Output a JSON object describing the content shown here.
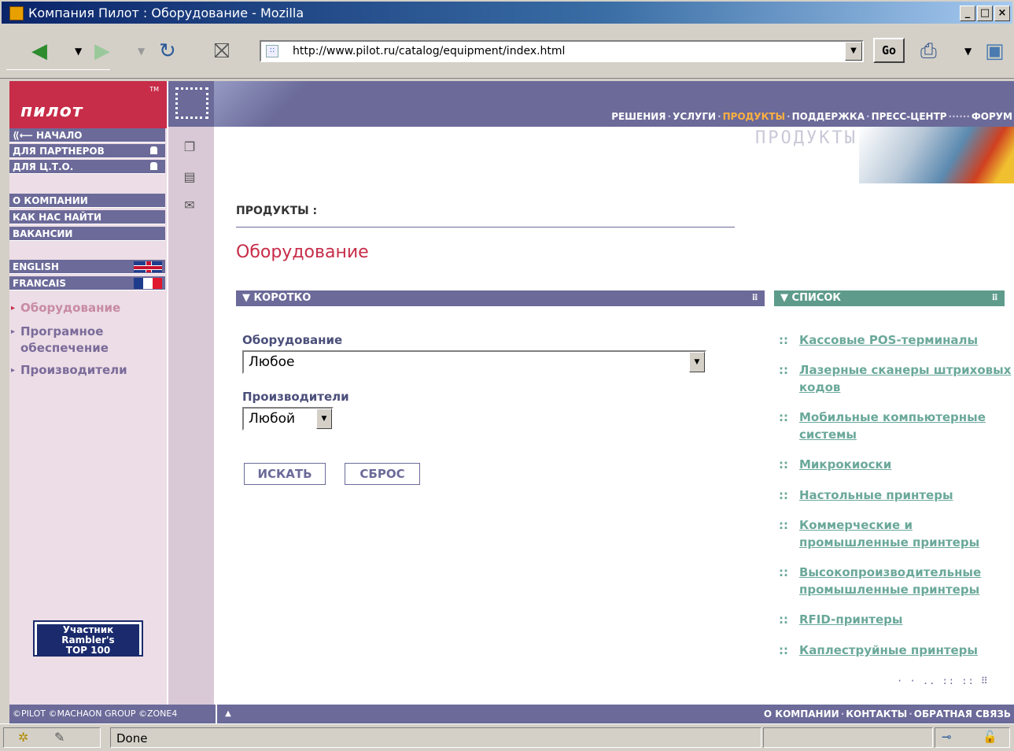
{
  "window": {
    "title": "Компания Пилот : Оборудование - Mozilla",
    "min_label": "_",
    "max_label": "□",
    "close_label": "×"
  },
  "toolbar": {
    "url": "http://www.pilot.ru/catalog/equipment/index.html",
    "go_label": "Go"
  },
  "sidebar": {
    "logo": "пилот",
    "logo_tm": "TM",
    "nav_top": [
      {
        "label": "⟪⟵ НАЧАЛО"
      },
      {
        "label": "ДЛЯ ПАРТНЕРОВ"
      },
      {
        "label": "ДЛЯ Ц.Т.О."
      }
    ],
    "nav_mid": [
      {
        "label": "О КОМПАНИИ"
      },
      {
        "label": "КАК НАС НАЙТИ"
      },
      {
        "label": "ВАКАНСИИ"
      }
    ],
    "lang": [
      {
        "label": "ENGLISH"
      },
      {
        "label": "FRANCAIS"
      }
    ],
    "links": [
      {
        "label": "Оборудование"
      },
      {
        "label": "Програмное обеспечение"
      },
      {
        "label": "Производители"
      }
    ],
    "rambler": [
      "Участник",
      "Rambler's",
      "TOP 100"
    ]
  },
  "topnav": {
    "items": [
      "РЕШЕНИЯ",
      "УСЛУГИ",
      "ПРОДУКТЫ",
      "ПОДДЕРЖКА",
      "ПРЕСС-ЦЕНТР",
      "ФОРУМ"
    ],
    "active": "ПРОДУКТЫ"
  },
  "hero": {
    "title": "ПРОДУКТЫ"
  },
  "content": {
    "breadcrumb": "ПРОДУКТЫ :",
    "page_title": "Оборудование",
    "section_short": "КОРОТКО",
    "section_list": "СПИСОК",
    "form": {
      "equipment_label": "Оборудование",
      "equipment_value": "Любое",
      "maker_label": "Производители",
      "maker_value": "Любой",
      "search_label": "ИСКАТЬ",
      "reset_label": "СБРОС"
    },
    "list": [
      "Кассовые POS-терминалы",
      "Лазерные сканеры штриховых кодов",
      "Мобильные компьютерные системы",
      "Микрокиоски",
      "Настольные принтеры",
      "Коммерческие и промышленные принтеры",
      "Высокопроизводительные промышленные принтеры",
      "RFID-принтеры",
      "Каплеструйные принтеры"
    ]
  },
  "footer": {
    "left": "©PILOT  ©MACHAON GROUP  ©ZONE4",
    "right": [
      "О КОМПАНИИ",
      "КОНТАКТЫ",
      "ОБРАТНАЯ СВЯЗЬ"
    ]
  },
  "status": {
    "text": "Done"
  },
  "colors": {
    "brand_red": "#c72c48",
    "nav_purple": "#6b6a99",
    "list_green": "#5e9b8a"
  }
}
